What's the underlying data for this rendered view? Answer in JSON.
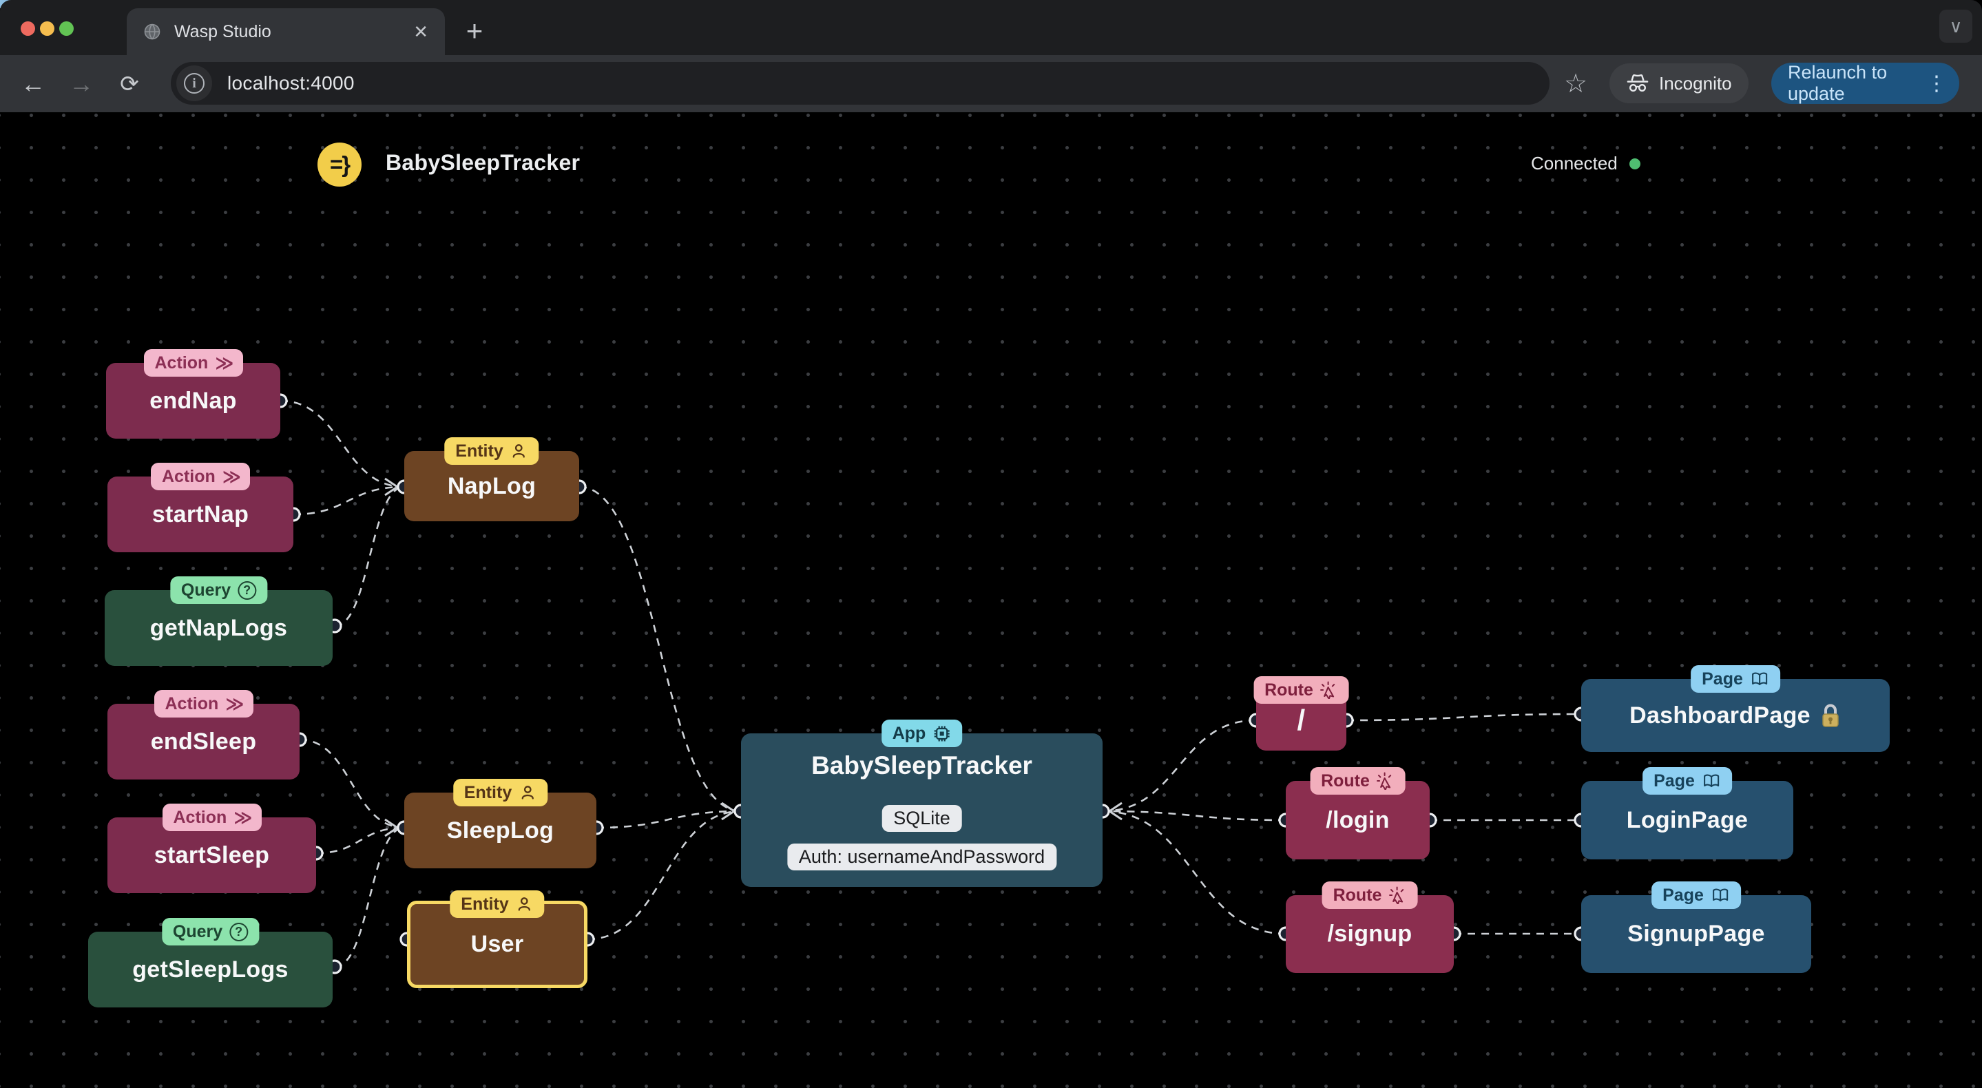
{
  "browser": {
    "tab_title": "Wasp Studio",
    "url": "localhost:4000",
    "incognito_label": "Incognito",
    "relaunch_button_label": "Relaunch to update"
  },
  "icons": {
    "new_tab": "+",
    "close_tab": "✕",
    "back": "←",
    "forward": "→",
    "reload": "⟳",
    "star": "☆",
    "kebab": "⋮",
    "window_chevron": "∨",
    "info": "i",
    "action_chevrons": "≫",
    "query_mark": "?"
  },
  "header": {
    "logo_glyph": "=}",
    "app_title": "BabySleepTracker",
    "connection_status": "Connected"
  },
  "nodes": {
    "endNap": {
      "type_label": "Action",
      "label": "endNap"
    },
    "startNap": {
      "type_label": "Action",
      "label": "startNap"
    },
    "getNapLogs": {
      "type_label": "Query",
      "label": "getNapLogs"
    },
    "endSleep": {
      "type_label": "Action",
      "label": "endSleep"
    },
    "startSleep": {
      "type_label": "Action",
      "label": "startSleep"
    },
    "getSleepLogs": {
      "type_label": "Query",
      "label": "getSleepLogs"
    },
    "napLog": {
      "type_label": "Entity",
      "label": "NapLog"
    },
    "sleepLog": {
      "type_label": "Entity",
      "label": "SleepLog"
    },
    "user": {
      "type_label": "Entity",
      "label": "User"
    },
    "app": {
      "type_label": "App",
      "label": "BabySleepTracker",
      "database_chip": "SQLite",
      "auth_chip": "Auth: usernameAndPassword"
    },
    "routeRoot": {
      "type_label": "Route",
      "label": "/"
    },
    "routeLogin": {
      "type_label": "Route",
      "label": "/login"
    },
    "routeSignup": {
      "type_label": "Route",
      "label": "/signup"
    },
    "dashboardPage": {
      "type_label": "Page",
      "label": "DashboardPage",
      "protected": true
    },
    "loginPage": {
      "type_label": "Page",
      "label": "LoginPage"
    },
    "signupPage": {
      "type_label": "Page",
      "label": "SignupPage"
    }
  },
  "colors": {
    "action_node": "#7d2c4e",
    "action_badge": "#f3b7cc",
    "query_node": "#29503d",
    "query_badge": "#8ce3ac",
    "entity_node": "#6d4423",
    "entity_badge": "#f7d964",
    "app_node": "#2a4d5d",
    "app_badge": "#82d9e9",
    "route_node": "#8b2e4f",
    "route_badge": "#f2aebc",
    "page_node": "#26506e",
    "page_badge": "#8fd0f2",
    "edge": "#cdd1d6",
    "connected_green": "#4fbe71",
    "wasp_yellow": "#f2cd4a",
    "relaunch_blue": "#1d5480"
  }
}
